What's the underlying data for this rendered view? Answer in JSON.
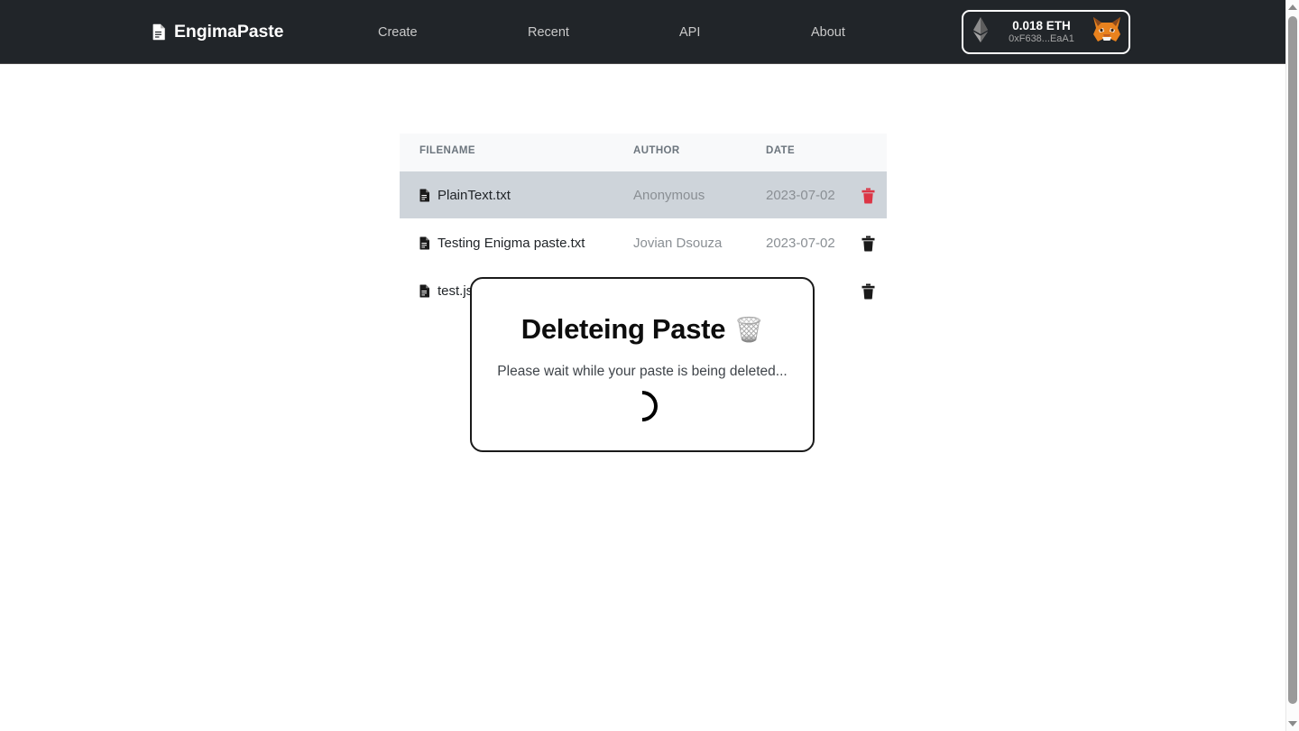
{
  "navbar": {
    "brand": {
      "label": "EngimaPaste",
      "icon": "file-document-icon"
    },
    "links": [
      {
        "label": "Create"
      },
      {
        "label": "Recent"
      },
      {
        "label": "API"
      },
      {
        "label": "About"
      }
    ],
    "wallet": {
      "chain_icon": "ethereum-diamond-icon",
      "balance": "0.018 ETH",
      "address": "0xF638...EaA1",
      "provider_icon": "metamask-fox-icon"
    },
    "colors": {
      "background": "#212529",
      "link": "#c9c9c9",
      "brand_text": "#ffffff"
    }
  },
  "table": {
    "columns": [
      "FILENAME",
      "AUTHOR",
      "DATE"
    ],
    "header_background": "#f8f9fa",
    "highlight_color": "#ced4da",
    "rows": [
      {
        "filename": "PlainText.txt",
        "author": "Anonymous",
        "date": "2023-07-02",
        "delete_icon": "trash-icon",
        "delete_icon_color": "#dc3545",
        "highlighted": true
      },
      {
        "filename": "Testing Enigma paste.txt",
        "author": "Jovian Dsouza",
        "date": "2023-07-02",
        "delete_icon": "trash-icon",
        "delete_icon_color": "#1a1a1a",
        "highlighted": false
      },
      {
        "filename": "test.js",
        "author": "",
        "date": "-01",
        "delete_icon": "trash-icon",
        "delete_icon_color": "#1a1a1a",
        "highlighted": false
      }
    ]
  },
  "modal": {
    "title": "Deleteing Paste",
    "title_icon": "wastebasket-emoji",
    "title_emoji": "🗑️",
    "subtitle": "Please wait while your paste is being deleted...",
    "spinner": "loading-spinner",
    "border_color": "#1a1a1a"
  },
  "scrollbar": {
    "up_arrow": "scroll-up-arrow-icon",
    "down_arrow": "scroll-down-arrow-icon",
    "thumb": "scrollbar-thumb"
  }
}
